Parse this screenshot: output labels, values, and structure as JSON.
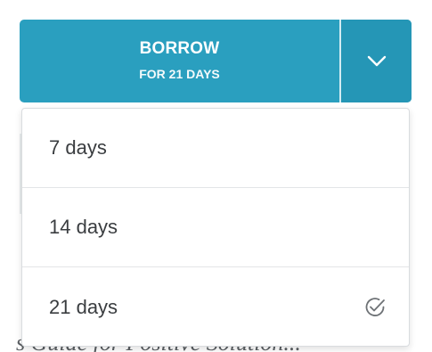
{
  "borrow": {
    "label": "BORROW",
    "sublabel": "FOR 21 DAYS",
    "toggle_icon": "chevron-down-icon",
    "color": "#2a9fbf"
  },
  "menu": {
    "items": [
      {
        "label": "7 days",
        "selected": false
      },
      {
        "label": "14 days",
        "selected": false
      },
      {
        "label": "21 days",
        "selected": true,
        "icon": "check-circle-icon"
      }
    ]
  },
  "background": {
    "partial_text": "s Guide for Positive Solution..."
  }
}
